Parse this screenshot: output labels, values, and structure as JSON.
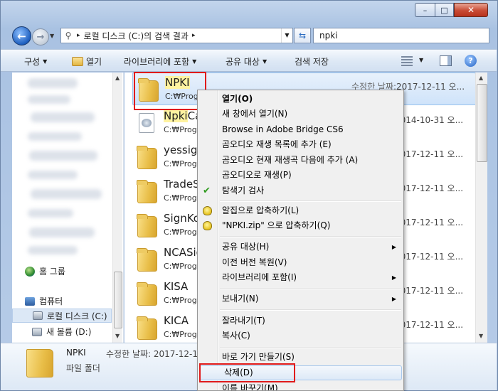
{
  "window": {
    "caption_min": "–",
    "caption_max": "□",
    "caption_close": "✕"
  },
  "nav": {
    "back_glyph": "←",
    "fwd_glyph": "→"
  },
  "address": {
    "segments": [
      "로컬 디스크 (C:)의 검색 결과"
    ],
    "separator": "▸"
  },
  "search": {
    "value": "npki"
  },
  "toolbar": {
    "organize": "구성",
    "open": "열기",
    "include_library": "라이브러리에 포함",
    "share_with": "공유 대상",
    "save_search": "검색 저장",
    "help": "?"
  },
  "navpane": {
    "homegroup": "홈 그룹",
    "computer": "컴퓨터",
    "local_disk": "로컬 디스크 (C:)",
    "new_volume": "새 볼륨 (D:)"
  },
  "files": [
    {
      "name_hl": "NPKI",
      "name_rest": "",
      "path": "C:₩Prog",
      "label": "수정한 날짜:",
      "date": "2017-12-11 오...",
      "icon": "folder",
      "selected": true
    },
    {
      "name_hl": "Npki",
      "name_rest": "Ca",
      "path": "C:₩Prog",
      "label": "",
      "date": "2014-10-31 오...",
      "icon": "file",
      "selected": false
    },
    {
      "name_hl": "",
      "name_rest": "yessign",
      "path": "C:₩Prog",
      "label": "",
      "date": "2017-12-11 오...",
      "icon": "folder",
      "selected": false
    },
    {
      "name_hl": "",
      "name_rest": "TradeS",
      "path": "C:₩Prog",
      "label": "",
      "date": "2017-12-11 오...",
      "icon": "folder",
      "selected": false
    },
    {
      "name_hl": "",
      "name_rest": "SignKo",
      "path": "C:₩Prog",
      "label": "",
      "date": "2017-12-11 오...",
      "icon": "folder",
      "selected": false
    },
    {
      "name_hl": "",
      "name_rest": "NCASig",
      "path": "C:₩Prog",
      "label": "",
      "date": "2017-12-11 오...",
      "icon": "folder",
      "selected": false
    },
    {
      "name_hl": "",
      "name_rest": "KISA",
      "path": "C:₩Prog",
      "label": "",
      "date": "2017-12-11 오...",
      "icon": "folder",
      "selected": false
    },
    {
      "name_hl": "",
      "name_rest": "KICA",
      "path": "C:₩Prog",
      "label": "",
      "date": "2017-12-11 오...",
      "icon": "folder",
      "selected": false
    }
  ],
  "details": {
    "name": "NPKI",
    "date": "수정한 날짜: 2017-12-1",
    "type": "파일 폴더"
  },
  "context_menu": {
    "open": "열기(O)",
    "open_new_window": "새 창에서 열기(N)",
    "browse_bridge": "Browse in Adobe Bridge CS6",
    "gom_add_playlist": "곰오디오 재생 목록에 추가 (E)",
    "gom_add_next": "곰오디오 현재 재생곡 다음에 추가 (A)",
    "gom_play": "곰오디오로 재생(P)",
    "av_scan": "탐색기 검사",
    "alzip_compress": "알집으로 압축하기(L)",
    "zip_compress": "\"NPKI.zip\" 으로 압축하기(Q)",
    "share_with": "공유 대상(H)",
    "restore_prev": "이전 버전 복원(V)",
    "include_library": "라이브러리에 포함(I)",
    "send_to": "보내기(N)",
    "cut": "잘라내기(T)",
    "copy": "복사(C)",
    "create_shortcut": "바로 가기 만들기(S)",
    "delete": "삭제(D)",
    "rename": "이름 바꾸기(M)",
    "submenu_arrow": "▶"
  }
}
